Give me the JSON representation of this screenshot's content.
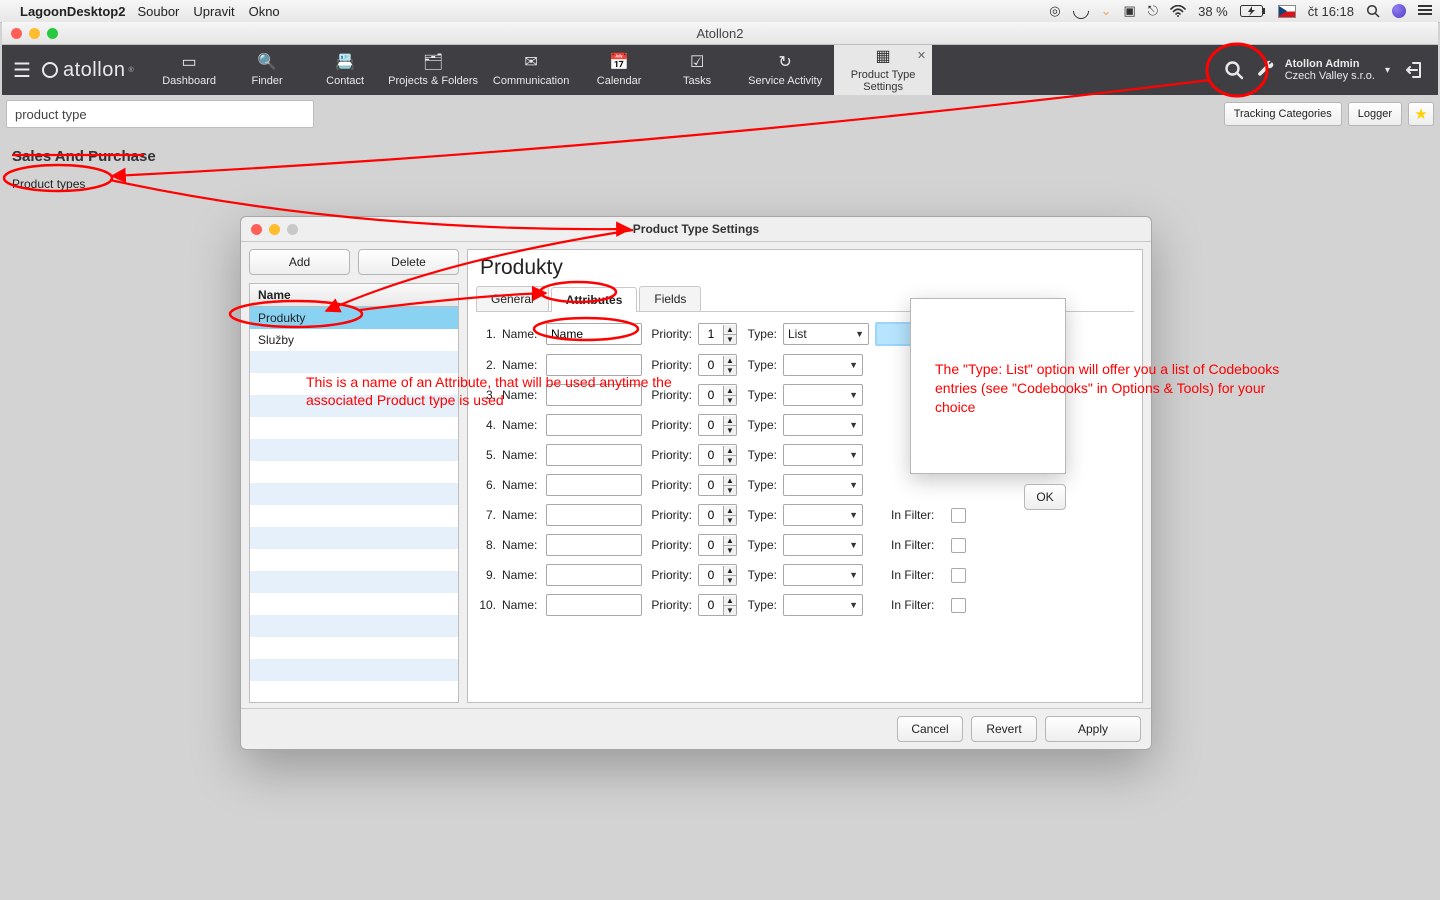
{
  "mac_menu": {
    "app_name": "LagoonDesktop2",
    "items": [
      "Soubor",
      "Upravit",
      "Okno"
    ],
    "battery_text": "38 %",
    "clock": "čt 16:18"
  },
  "main_window": {
    "title": "Atollon2"
  },
  "brand": "atollon",
  "nav_tabs": [
    {
      "label": "Dashboard",
      "icon": "▭"
    },
    {
      "label": "Finder",
      "icon": "🔍"
    },
    {
      "label": "Contact",
      "icon": "📇"
    },
    {
      "label": "Projects & Folders",
      "icon": "🗂"
    },
    {
      "label": "Communication",
      "icon": "✉"
    },
    {
      "label": "Calendar",
      "icon": "📅"
    },
    {
      "label": "Tasks",
      "icon": "☑"
    },
    {
      "label": "Service Activity",
      "icon": "↻"
    }
  ],
  "nav_active": {
    "line1": "Product Type",
    "line2": "Settings",
    "icon": "▦",
    "close": "✕"
  },
  "account": {
    "user": "Atollon Admin",
    "org": "Czech Valley s.r.o."
  },
  "subbar": {
    "search_value": "product type",
    "buttons": [
      "Tracking Categories",
      "Logger"
    ]
  },
  "category": {
    "heading": "Sales And Purchase",
    "link": "Product types"
  },
  "dialog": {
    "title": "Product Type Settings",
    "add": "Add",
    "delete": "Delete",
    "col_head": "Name",
    "rows": [
      "Produkty",
      "Služby"
    ],
    "selected_index": 0,
    "form_title": "Produkty",
    "tabs": [
      "General",
      "Attributes",
      "Fields"
    ],
    "active_tab": 1,
    "attr_labels": {
      "name": "Name:",
      "priority": "Priority:",
      "type": "Type:",
      "infilter": "In Filter:"
    },
    "ok": "OK",
    "attrs": [
      {
        "idx": "1.",
        "name": "Name",
        "priority": "1",
        "type": "List",
        "has_bluebox": true,
        "infilter": true
      },
      {
        "idx": "2.",
        "name": "",
        "priority": "0",
        "type": "",
        "infilter": false
      },
      {
        "idx": "3.",
        "name": "",
        "priority": "0",
        "type": "",
        "infilter": false
      },
      {
        "idx": "4.",
        "name": "",
        "priority": "0",
        "type": "",
        "infilter": false
      },
      {
        "idx": "5.",
        "name": "",
        "priority": "0",
        "type": "",
        "infilter": false
      },
      {
        "idx": "6.",
        "name": "",
        "priority": "0",
        "type": "",
        "infilter": false
      },
      {
        "idx": "7.",
        "name": "",
        "priority": "0",
        "type": "",
        "infilter": true
      },
      {
        "idx": "8.",
        "name": "",
        "priority": "0",
        "type": "",
        "infilter": true
      },
      {
        "idx": "9.",
        "name": "",
        "priority": "0",
        "type": "",
        "infilter": true
      },
      {
        "idx": "10.",
        "name": "",
        "priority": "0",
        "type": "",
        "infilter": true
      }
    ],
    "footer": {
      "cancel": "Cancel",
      "revert": "Revert",
      "apply": "Apply"
    }
  },
  "annotations": {
    "attr_note": "This is a name of an Attribute, that will be used anytime the associated Product type is used",
    "type_note": "The \"Type: List\" option will offer you a list of Codebooks entries (see \"Codebooks\" in Options & Tools) for your choice"
  }
}
